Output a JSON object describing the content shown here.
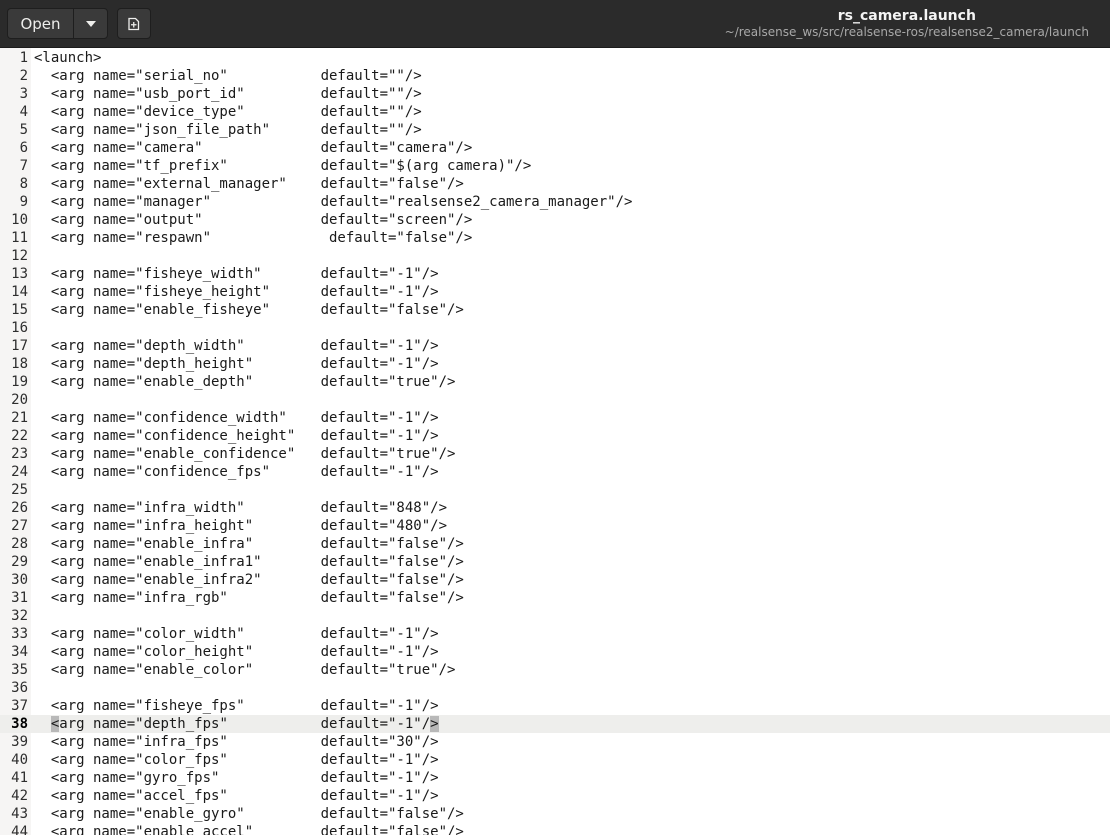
{
  "header": {
    "open_label": "Open",
    "file_name": "rs_camera.launch",
    "file_path": "~/realsense_ws/src/realsense-ros/realsense2_camera/launch"
  },
  "editor": {
    "current_line": 38,
    "lines": [
      {
        "n": "1",
        "text": "<launch>"
      },
      {
        "n": "2",
        "text": "  <arg name=\"serial_no\"           default=\"\"/>"
      },
      {
        "n": "3",
        "text": "  <arg name=\"usb_port_id\"         default=\"\"/>"
      },
      {
        "n": "4",
        "text": "  <arg name=\"device_type\"         default=\"\"/>"
      },
      {
        "n": "5",
        "text": "  <arg name=\"json_file_path\"      default=\"\"/>"
      },
      {
        "n": "6",
        "text": "  <arg name=\"camera\"              default=\"camera\"/>"
      },
      {
        "n": "7",
        "text": "  <arg name=\"tf_prefix\"           default=\"$(arg camera)\"/>"
      },
      {
        "n": "8",
        "text": "  <arg name=\"external_manager\"    default=\"false\"/>"
      },
      {
        "n": "9",
        "text": "  <arg name=\"manager\"             default=\"realsense2_camera_manager\"/>"
      },
      {
        "n": "10",
        "text": "  <arg name=\"output\"              default=\"screen\"/>"
      },
      {
        "n": "11",
        "text": "  <arg name=\"respawn\"              default=\"false\"/>"
      },
      {
        "n": "12",
        "text": ""
      },
      {
        "n": "13",
        "text": "  <arg name=\"fisheye_width\"       default=\"-1\"/>"
      },
      {
        "n": "14",
        "text": "  <arg name=\"fisheye_height\"      default=\"-1\"/>"
      },
      {
        "n": "15",
        "text": "  <arg name=\"enable_fisheye\"      default=\"false\"/>"
      },
      {
        "n": "16",
        "text": ""
      },
      {
        "n": "17",
        "text": "  <arg name=\"depth_width\"         default=\"-1\"/>"
      },
      {
        "n": "18",
        "text": "  <arg name=\"depth_height\"        default=\"-1\"/>"
      },
      {
        "n": "19",
        "text": "  <arg name=\"enable_depth\"        default=\"true\"/>"
      },
      {
        "n": "20",
        "text": ""
      },
      {
        "n": "21",
        "text": "  <arg name=\"confidence_width\"    default=\"-1\"/>"
      },
      {
        "n": "22",
        "text": "  <arg name=\"confidence_height\"   default=\"-1\"/>"
      },
      {
        "n": "23",
        "text": "  <arg name=\"enable_confidence\"   default=\"true\"/>"
      },
      {
        "n": "24",
        "text": "  <arg name=\"confidence_fps\"      default=\"-1\"/>"
      },
      {
        "n": "25",
        "text": ""
      },
      {
        "n": "26",
        "text": "  <arg name=\"infra_width\"         default=\"848\"/>"
      },
      {
        "n": "27",
        "text": "  <arg name=\"infra_height\"        default=\"480\"/>"
      },
      {
        "n": "28",
        "text": "  <arg name=\"enable_infra\"        default=\"false\"/>"
      },
      {
        "n": "29",
        "text": "  <arg name=\"enable_infra1\"       default=\"false\"/>"
      },
      {
        "n": "30",
        "text": "  <arg name=\"enable_infra2\"       default=\"false\"/>"
      },
      {
        "n": "31",
        "text": "  <arg name=\"infra_rgb\"           default=\"false\"/>"
      },
      {
        "n": "32",
        "text": ""
      },
      {
        "n": "33",
        "text": "  <arg name=\"color_width\"         default=\"-1\"/>"
      },
      {
        "n": "34",
        "text": "  <arg name=\"color_height\"        default=\"-1\"/>"
      },
      {
        "n": "35",
        "text": "  <arg name=\"enable_color\"        default=\"true\"/>"
      },
      {
        "n": "36",
        "text": ""
      },
      {
        "n": "37",
        "text": "  <arg name=\"fisheye_fps\"         default=\"-1\"/>"
      },
      {
        "n": "38",
        "text": "  <arg name=\"depth_fps\"           default=\"-1\"/>"
      },
      {
        "n": "39",
        "text": "  <arg name=\"infra_fps\"           default=\"30\"/>"
      },
      {
        "n": "40",
        "text": "  <arg name=\"color_fps\"           default=\"-1\"/>"
      },
      {
        "n": "41",
        "text": "  <arg name=\"gyro_fps\"            default=\"-1\"/>"
      },
      {
        "n": "42",
        "text": "  <arg name=\"accel_fps\"           default=\"-1\"/>"
      },
      {
        "n": "43",
        "text": "  <arg name=\"enable_gyro\"         default=\"false\"/>"
      },
      {
        "n": "44",
        "text": "  <arg name=\"enable_accel\"        default=\"false\"/>"
      }
    ]
  }
}
